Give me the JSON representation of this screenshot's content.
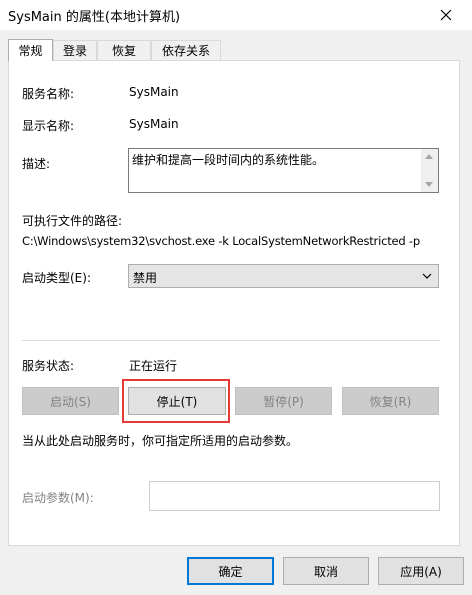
{
  "window": {
    "title": "SysMain 的属性(本地计算机)"
  },
  "tabs": [
    {
      "label": "常规"
    },
    {
      "label": "登录"
    },
    {
      "label": "恢复"
    },
    {
      "label": "依存关系"
    }
  ],
  "general": {
    "service_name_label": "服务名称:",
    "service_name_value": "SysMain",
    "display_name_label": "显示名称:",
    "display_name_value": "SysMain",
    "description_label": "描述:",
    "description_value": "维护和提高一段时间内的系统性能。",
    "exe_path_label": "可执行文件的路径:",
    "exe_path_value": "C:\\Windows\\system32\\svchost.exe -k LocalSystemNetworkRestricted -p",
    "startup_type_label": "启动类型(E):",
    "startup_type_value": "禁用",
    "status_label": "服务状态:",
    "status_value": "正在运行",
    "start_button": "启动(S)",
    "stop_button": "停止(T)",
    "pause_button": "暂停(P)",
    "resume_button": "恢复(R)",
    "hint_text": "当从此处启动服务时，你可指定所适用的启动参数。",
    "start_params_label": "启动参数(M):",
    "start_params_value": ""
  },
  "footer": {
    "ok_button": "确定",
    "cancel_button": "取消",
    "apply_button": "应用(A)"
  },
  "colors": {
    "highlight": "#e53935",
    "default_button_border": "#0078d7"
  },
  "icons": {
    "close": "close-icon",
    "dropdown": "chevron-down-icon"
  }
}
